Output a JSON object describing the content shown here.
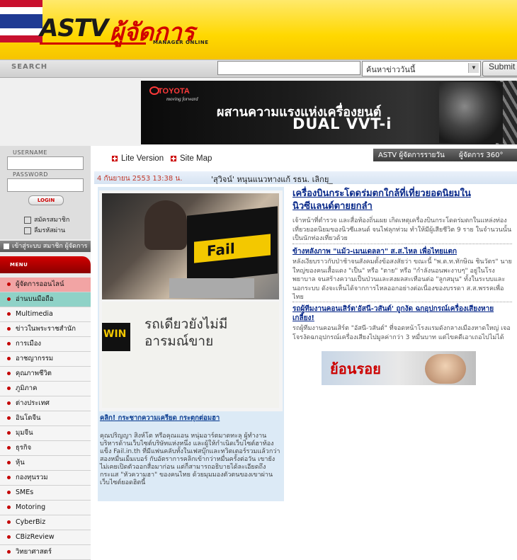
{
  "header": {
    "logo_brand": "ASTV",
    "logo_thai": "ผู้จัดการ",
    "logo_sub": "MANAGER ONLINE"
  },
  "search": {
    "label": "SEARCH",
    "input_value": "",
    "select_value": "ค้นหาข่าววันนี้",
    "button_label": "Submit"
  },
  "banner": {
    "brand": "TOYOTA",
    "slogan": "moving forward",
    "headline": "ผสานความแรงแห่งเครื่องยนต์",
    "tagline": "DUAL VVT-i"
  },
  "login": {
    "username_label": "USERNAME",
    "password_label": "PASSWORD",
    "login_button": "LOGIN",
    "register_link": "สมัครสมาชิก",
    "forgot_link": "ลืมรหัสผ่าน",
    "mobile_link": "เข้าสู่ระบบ สมาชิก ผู้จัดการ"
  },
  "menu": {
    "title": "MENU",
    "items": [
      "ผู้จัดการออนไลน์",
      "อ่านบนมือถือ",
      "Multimedia",
      "ข่าวในพระราชสำนัก",
      "การเมือง",
      "อาชญากรรม",
      "คุณภาพชีวิต",
      "ภูมิภาค",
      "ต่างประเทศ",
      "อินโดจีน",
      "มุมจีน",
      "ธุรกิจ",
      "หุ้น",
      "กองทุนรวม",
      "SMEs",
      "Motoring",
      "CyberBiz",
      "CBizReview",
      "วิทยาศาสตร์"
    ]
  },
  "topnav": {
    "lite_version": "Lite Version",
    "site_map": "Site Map",
    "daily_link": "ASTV ผู้จัดการรายวัน",
    "weekly_link": "ผู้จัดการ 360°"
  },
  "ticker": {
    "date": "4 กันยายน 2553 13:38 น.",
    "headline": "'สุวิจน์' หนุนแนวทางแก้ รธน. เลิกยุ_"
  },
  "photo_story": {
    "laptop_screen": "Fail",
    "sign_win": "WIN",
    "sign_text": "รถเดียวยังไม่มีอารมณ์ขาย",
    "caption": "คลิก! กระชากความเครียด กระตุกต่อมฮา",
    "body": "คุณปริญญา สิงห์โต หรือคุณแอน หนุ่มอาร์ตมาดทะลุ ผู้ทำงานบริหารด้านเว็บไซต์บริษัทแห่งหนึ่ง และผู้ให้กำเนิดเว็บไซต์ฮาท้องแข็ง Fail.in.th ที่มีแฟนคลับทั้งในเฟสบุ๊กและทวิตเตอร์รวมแล้วกว่าสองหมื่นเม็มเบอร์ กับอัตราการคลิกเข้ากว่าหมื่นครั้งต่อวัน เขายังไม่เคยเปิดตัวออกสื่อมาก่อน แต่ก็สามารถอธิบายได้ละเอียดถึงกระแส \"หัวความฮา\" ของคนไทย ด้วยมุมมองตัวตนของเขาผ่านเว็บไซต์ยอดฮิตนี้"
  },
  "news": [
    {
      "title": "เครื่องบินกระโดดร่มตกใกล้ที่เที่ยวยอดนิยมในนิวซีแลนด์ตายยกลำ",
      "body": "เจ้าหน้าที่ตำรวจ และสื่อท้องถิ่นเผย เกิดเหตุเครื่องบินกระโดดร่มตกในแหล่งท่องเที่ยวยอดนิยมของนิวซีแลนด์ จนไฟลุกท่วม ทำให้มีผู้เสียชีวิต 9 ราย ในจำนวนนั้นเป็นนักท่องเที่ยวด้วย"
    },
    {
      "title": "ข้างหลังภาพ \"แม้ว-เมนเดลลา\" ส.ส.ไหล เพื่อไทยแตก",
      "body": "หลังเงียบราวกับป่าช้าจนสังคมตั้งข้อสงสัยว่า ขณะนี้ \"พ.ต.ท.ทักษิณ ชินวัตร\" นาย ใหญ่ของคนเสื้อแดง \"เป็น\" หรือ \"ตาย\" หรือ \"กำลังนอนพะงาบๆ\" อยู่ในโรงพยาบาล จนสร้างความเป็นป่วนและสงผลสะเทือนต่อ \"ลูกสมุน\" ทั้งในระบบและนอกระบบ ดังจะเห็นได้จากการไหลออกอย่างต่อเนื่องของบรรดา ส.ส.พรรคเพื่อไทย"
    },
    {
      "title": "รถผู้ทีมงานคอนเสิร์ต'อัสนี-วสันต์' ถูกงัด ฉกอุปกรณ์เครื่องเสียงหายเกลี้ยง!",
      "body": "รถผู้ทีมงานคอนเสิร์ต \"อัสนี-วสันต์\" ที่จอดหน้าโรงแรมดังกลางเมืองหาดใหญ่ เจอโจรงัดฉกอุปกรณ์เครื่องเสียงไปมูลค่ากว่า 3 หมื่นบาท แต่ไขคดีเอาเถอไปไม่ได้"
    }
  ],
  "ad": {
    "text": "ย้อนรอย"
  },
  "colors": {
    "brand_yellow": "#ffd800",
    "brand_red": "#d10000",
    "link_blue": "#0a2a8a"
  }
}
